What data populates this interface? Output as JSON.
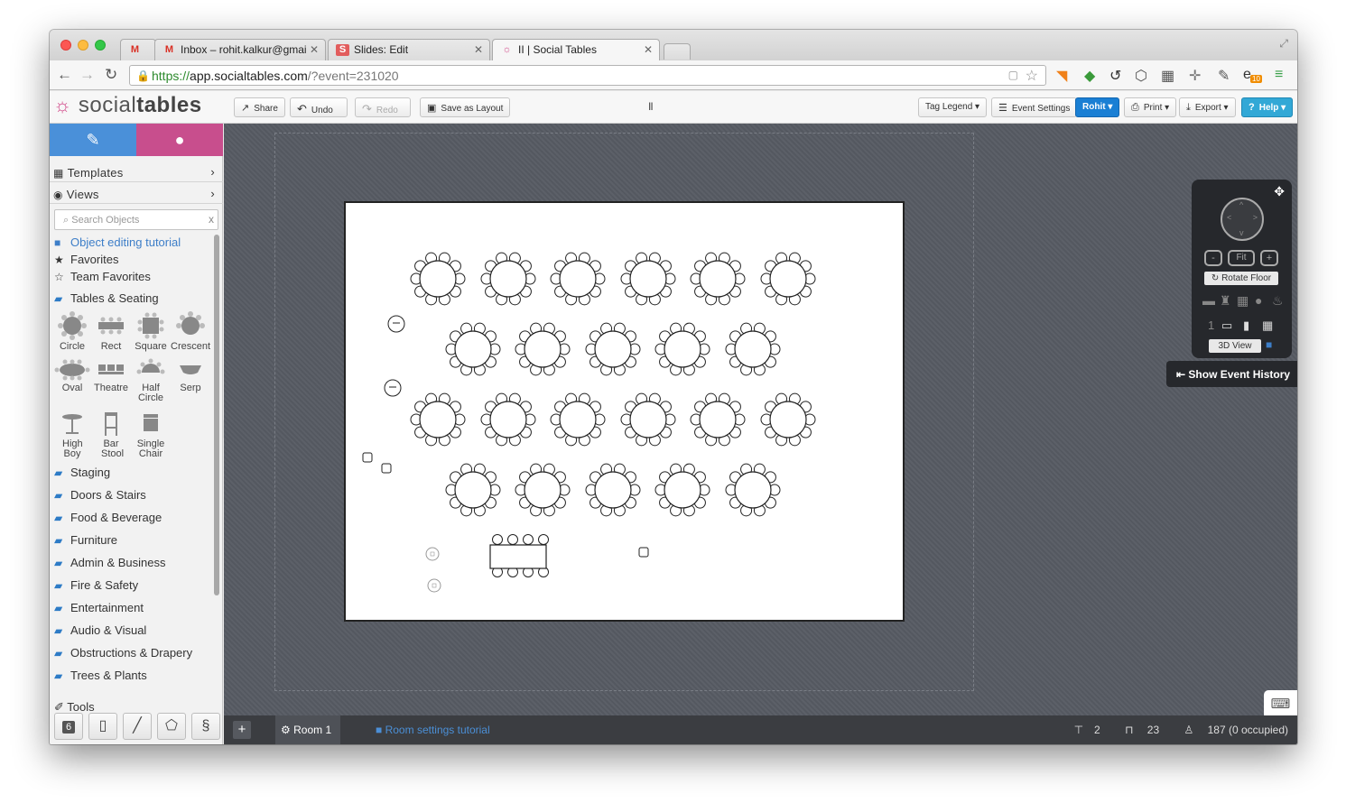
{
  "browser": {
    "tabs": [
      {
        "label": "",
        "icon": "gmail-icon"
      },
      {
        "label": "Inbox – rohit.kalkur@gmai",
        "icon": "gmail-icon"
      },
      {
        "label": "Slides: Edit",
        "icon": "slides-icon"
      },
      {
        "label": "II | Social Tables",
        "icon": "socialtables-icon"
      }
    ],
    "url": {
      "scheme": "https://",
      "host": "app.socialtables.com",
      "path": "/?event=231020"
    },
    "extension_badge": "10"
  },
  "header": {
    "logo": {
      "light": "social",
      "bold": "tables"
    },
    "share": "Share",
    "undo": "Undo",
    "redo": "Redo",
    "save_layout": "Save as Layout",
    "pause_mark": "II",
    "tag_legend": "Tag Legend",
    "event_settings": "Event Settings",
    "user": "Rohit",
    "print": "Print",
    "export": "Export",
    "help": "Help"
  },
  "sidebar": {
    "templates": "Templates",
    "views": "Views",
    "search_placeholder": "Search Objects",
    "tutorial": "Object editing tutorial",
    "favorites": "Favorites",
    "team_favorites": "Team Favorites",
    "tables_seating": "Tables & Seating",
    "objects": [
      {
        "label": "Circle"
      },
      {
        "label": "Rect"
      },
      {
        "label": "Square"
      },
      {
        "label": "Crescent"
      },
      {
        "label": "Oval"
      },
      {
        "label": "Theatre"
      },
      {
        "label": "Half Circle"
      },
      {
        "label": "Serp"
      },
      {
        "label": "High Boy"
      },
      {
        "label": "Bar Stool"
      },
      {
        "label": "Single Chair"
      }
    ],
    "categories": [
      "Staging",
      "Doors & Stairs",
      "Food & Beverage",
      "Furniture",
      "Admin & Business",
      "Fire & Safety",
      "Entertainment",
      "Audio & Visual",
      "Obstructions & Drapery",
      "Trees & Plants"
    ],
    "tools_label": "Tools",
    "tool_badge": "6",
    "collapse": "<<"
  },
  "nav_panel": {
    "zoom_out": "-",
    "fit": "Fit",
    "zoom_in": "+",
    "rotate": "Rotate Floor",
    "view_3d": "3D View",
    "floor_number": "1"
  },
  "history": "Show Event History",
  "bottom": {
    "add": "+",
    "room": "Room 1",
    "room_tutorial": "Room settings tutorial",
    "highboys": "2",
    "tables": "23",
    "guests": "187 (0 occupied)"
  },
  "colors": {
    "edit_tab": "#4a90d9",
    "people_tab": "#c84e8d",
    "canvas": "#575b63",
    "accent_blue": "#1a7fd4"
  }
}
